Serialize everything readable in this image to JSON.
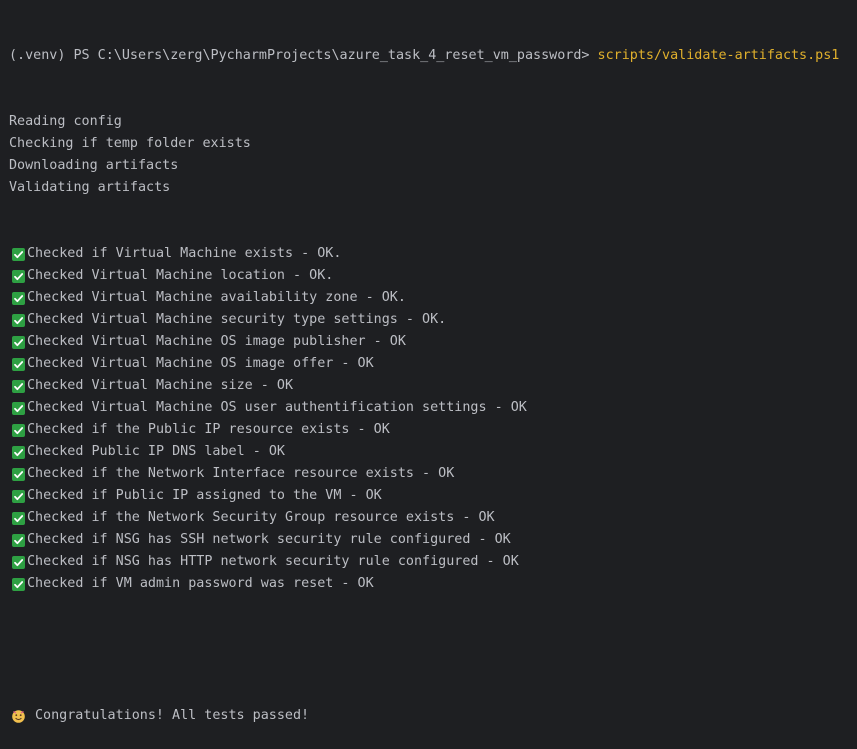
{
  "theme": {
    "background": "#1e1f22",
    "text": "#bcbec4",
    "command": "#e0b02c",
    "check": "#2ea043"
  },
  "prompt": {
    "prefix": "(.venv) PS C:\\Users\\zerg\\PycharmProjects\\azure_task_4_reset_vm_password> ",
    "command": "scripts/validate-artifacts.ps1"
  },
  "log_lines": [
    "Reading config",
    "Checking if temp folder exists",
    "Downloading artifacts",
    "Validating artifacts"
  ],
  "checks": [
    "Checked if Virtual Machine exists - OK.",
    "Checked Virtual Machine location - OK.",
    "Checked Virtual Machine availability zone - OK.",
    "Checked Virtual Machine security type settings - OK.",
    "Checked Virtual Machine OS image publisher - OK",
    "Checked Virtual Machine OS image offer - OK",
    "Checked Virtual Machine size - OK",
    "Checked Virtual Machine OS user authentification settings - OK",
    "Checked if the Public IP resource exists - OK",
    "Checked Public IP DNS label - OK",
    "Checked if the Network Interface resource exists - OK",
    "Checked if Public IP assigned to the VM - OK",
    "Checked if the Network Security Group resource exists - OK",
    "Checked if NSG has SSH network security rule configured - OK",
    "Checked if NSG has HTTP network security rule configured - OK",
    "Checked if VM admin password was reset - OK"
  ],
  "check_icon": "green-checkmark-icon",
  "result": {
    "icon": "party-popper-icon",
    "text": "Congratulations! All tests passed!"
  }
}
